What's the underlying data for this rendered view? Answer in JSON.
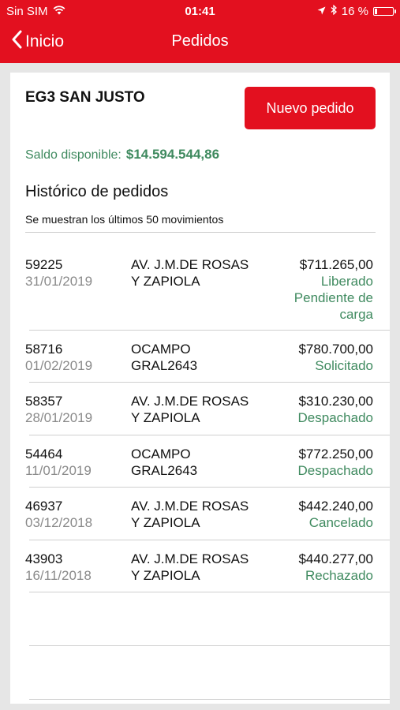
{
  "status_bar": {
    "carrier": "Sin SIM",
    "time": "01:41",
    "battery_percent": "16 %",
    "battery_level": 0.16
  },
  "nav": {
    "back_label": "Inicio",
    "title": "Pedidos"
  },
  "store": {
    "name": "EG3 SAN JUSTO",
    "new_order_label": "Nuevo pedido",
    "balance_label": "Saldo disponible:",
    "balance_amount": "$14.594.544,86"
  },
  "history": {
    "title": "Histórico de pedidos",
    "subtitle": "Se muestran los últimos 50 movimientos",
    "orders": [
      {
        "id": "59225",
        "date": "31/01/2019",
        "address": "AV. J.M.DE ROSAS Y ZAPIOLA",
        "amount": "$711.265,00",
        "status": "Liberado Pendiente de carga"
      },
      {
        "id": "58716",
        "date": "01/02/2019",
        "address": "OCAMPO GRAL2643",
        "amount": "$780.700,00",
        "status": "Solicitado"
      },
      {
        "id": "58357",
        "date": "28/01/2019",
        "address": "AV. J.M.DE ROSAS Y ZAPIOLA",
        "amount": "$310.230,00",
        "status": "Despachado"
      },
      {
        "id": "54464",
        "date": "11/01/2019",
        "address": "OCAMPO GRAL2643",
        "amount": "$772.250,00",
        "status": "Despachado"
      },
      {
        "id": "46937",
        "date": "03/12/2018",
        "address": "AV. J.M.DE ROSAS Y ZAPIOLA",
        "amount": "$442.240,00",
        "status": "Cancelado"
      },
      {
        "id": "43903",
        "date": "16/11/2018",
        "address": "AV. J.M.DE ROSAS Y ZAPIOLA",
        "amount": "$440.277,00",
        "status": "Rechazado"
      }
    ]
  },
  "colors": {
    "brand_red": "#e3101f",
    "status_green": "#3f8a5f",
    "date_gray": "#8a8a8a"
  }
}
